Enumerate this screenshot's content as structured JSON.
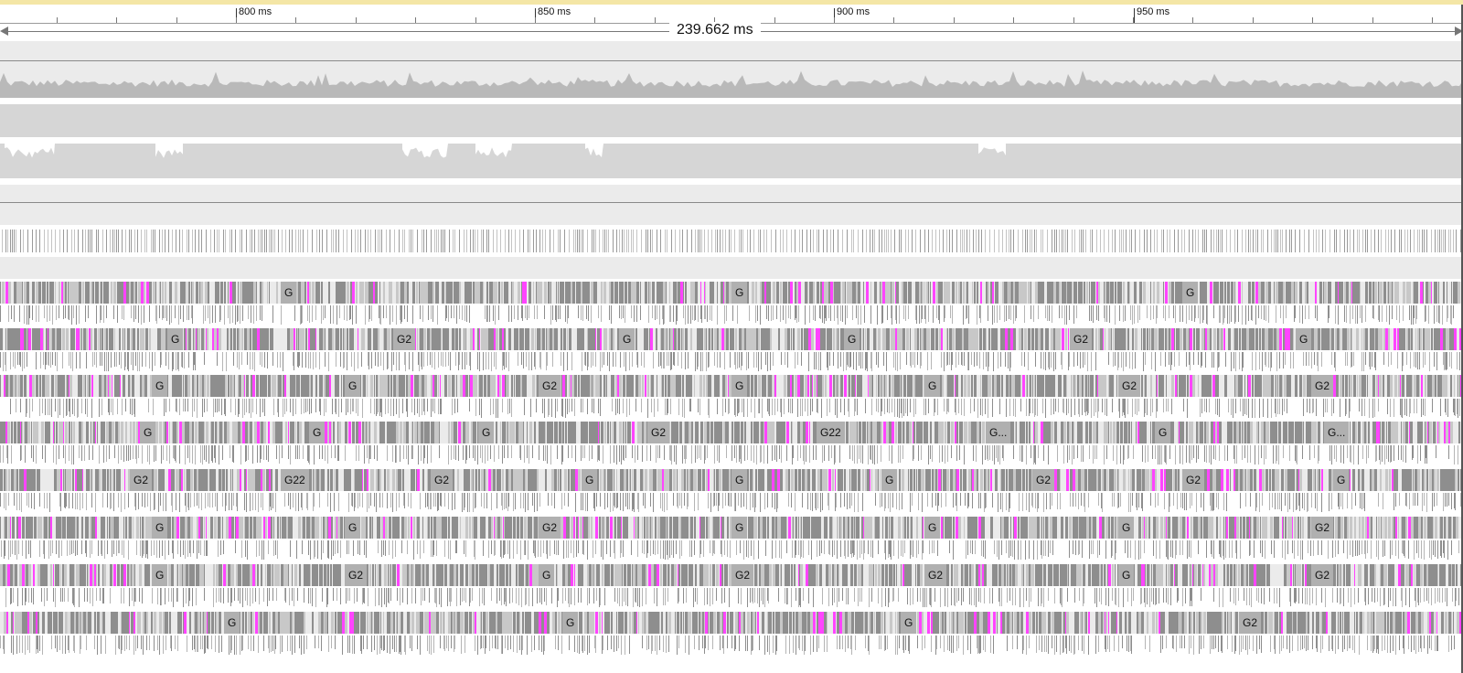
{
  "ruler": {
    "labels": [
      "800 ms",
      "850 ms",
      "900 ms",
      "950 ms"
    ]
  },
  "measure": {
    "duration": "239.662 ms"
  },
  "colors": {
    "gc_highlight": "#ff44ff",
    "bar_dark": "#8e8e8e",
    "bar_light": "#c8c8c8",
    "track_bg": "#ebebeb",
    "label_box": "#b0b0b0"
  },
  "threads": [
    {
      "labels": [
        "G",
        "G",
        "G"
      ]
    },
    {
      "labels": [
        "G",
        "G2",
        "G",
        "G",
        "G2",
        "G"
      ]
    },
    {
      "labels": [
        "G",
        "G",
        "G2",
        "G",
        "G",
        "G2",
        "G2"
      ]
    },
    {
      "labels": [
        "G",
        "G",
        "G",
        "G2",
        "G22",
        "G...",
        "G",
        "G..."
      ]
    },
    {
      "labels": [
        "G2",
        "G22",
        "G2",
        "G",
        "G",
        "G",
        "G2",
        "G2",
        "G"
      ]
    },
    {
      "labels": [
        "G",
        "G",
        "G2",
        "G",
        "G",
        "G",
        "G2"
      ]
    },
    {
      "labels": [
        "G",
        "G2",
        "G",
        "G2",
        "G2",
        "G",
        "G2"
      ]
    },
    {
      "labels": [
        "G",
        "G",
        "G",
        "G2"
      ]
    }
  ]
}
